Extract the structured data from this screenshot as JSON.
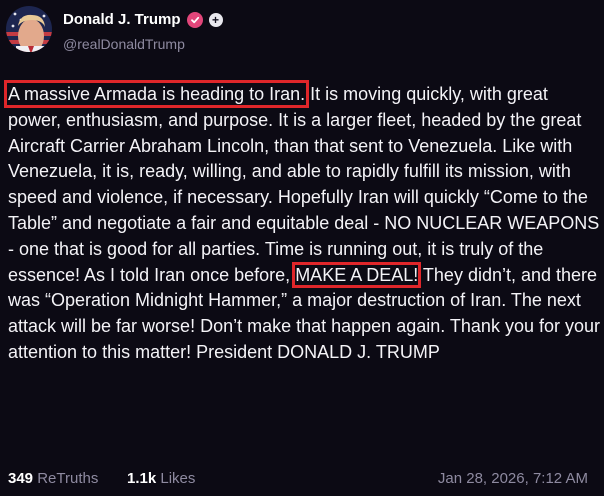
{
  "author": {
    "display_name": "Donald J. Trump",
    "handle": "@realDonaldTrump",
    "avatar_icon": "profile-photo",
    "verified_icon": "verified-badge-icon",
    "subscribe_icon": "plus-icon"
  },
  "post": {
    "highlight_1": "A massive Armada is heading to Iran.",
    "text_part_2": " It is moving quickly, with great power, enthusiasm, and purpose. It is a larger fleet, headed by the great Aircraft Carrier Abraham Lincoln, than that sent to Venezuela. Like with Venezuela, it is, ready, willing, and able to rapidly fulfill its mission, with speed and violence, if necessary. Hopefully Iran will quickly “Come to the Table” and negotiate a fair and equitable deal - NO NUCLEAR WEAPONS - one that is good for all parties. Time is running out, it is truly of the essence! As I told Iran once before, ",
    "highlight_2": "MAKE A DEAL!",
    "text_part_3": " They didn’t, and there was “Operation Midnight Hammer,” a major destruction of Iran. The next attack will be far worse! Don’t make that happen again. Thank you for your attention to this matter!  President DONALD J. TRUMP"
  },
  "footer": {
    "retruths_count": "349",
    "retruths_label": "ReTruths",
    "likes_count": "1.1k",
    "likes_label": "Likes",
    "timestamp": "Jan 28, 2026, 7:12 AM"
  },
  "colors": {
    "background": "#0c0a14",
    "highlight_border": "#e0262a",
    "verified": "#e2467a",
    "muted_text": "#8e8aa0"
  }
}
